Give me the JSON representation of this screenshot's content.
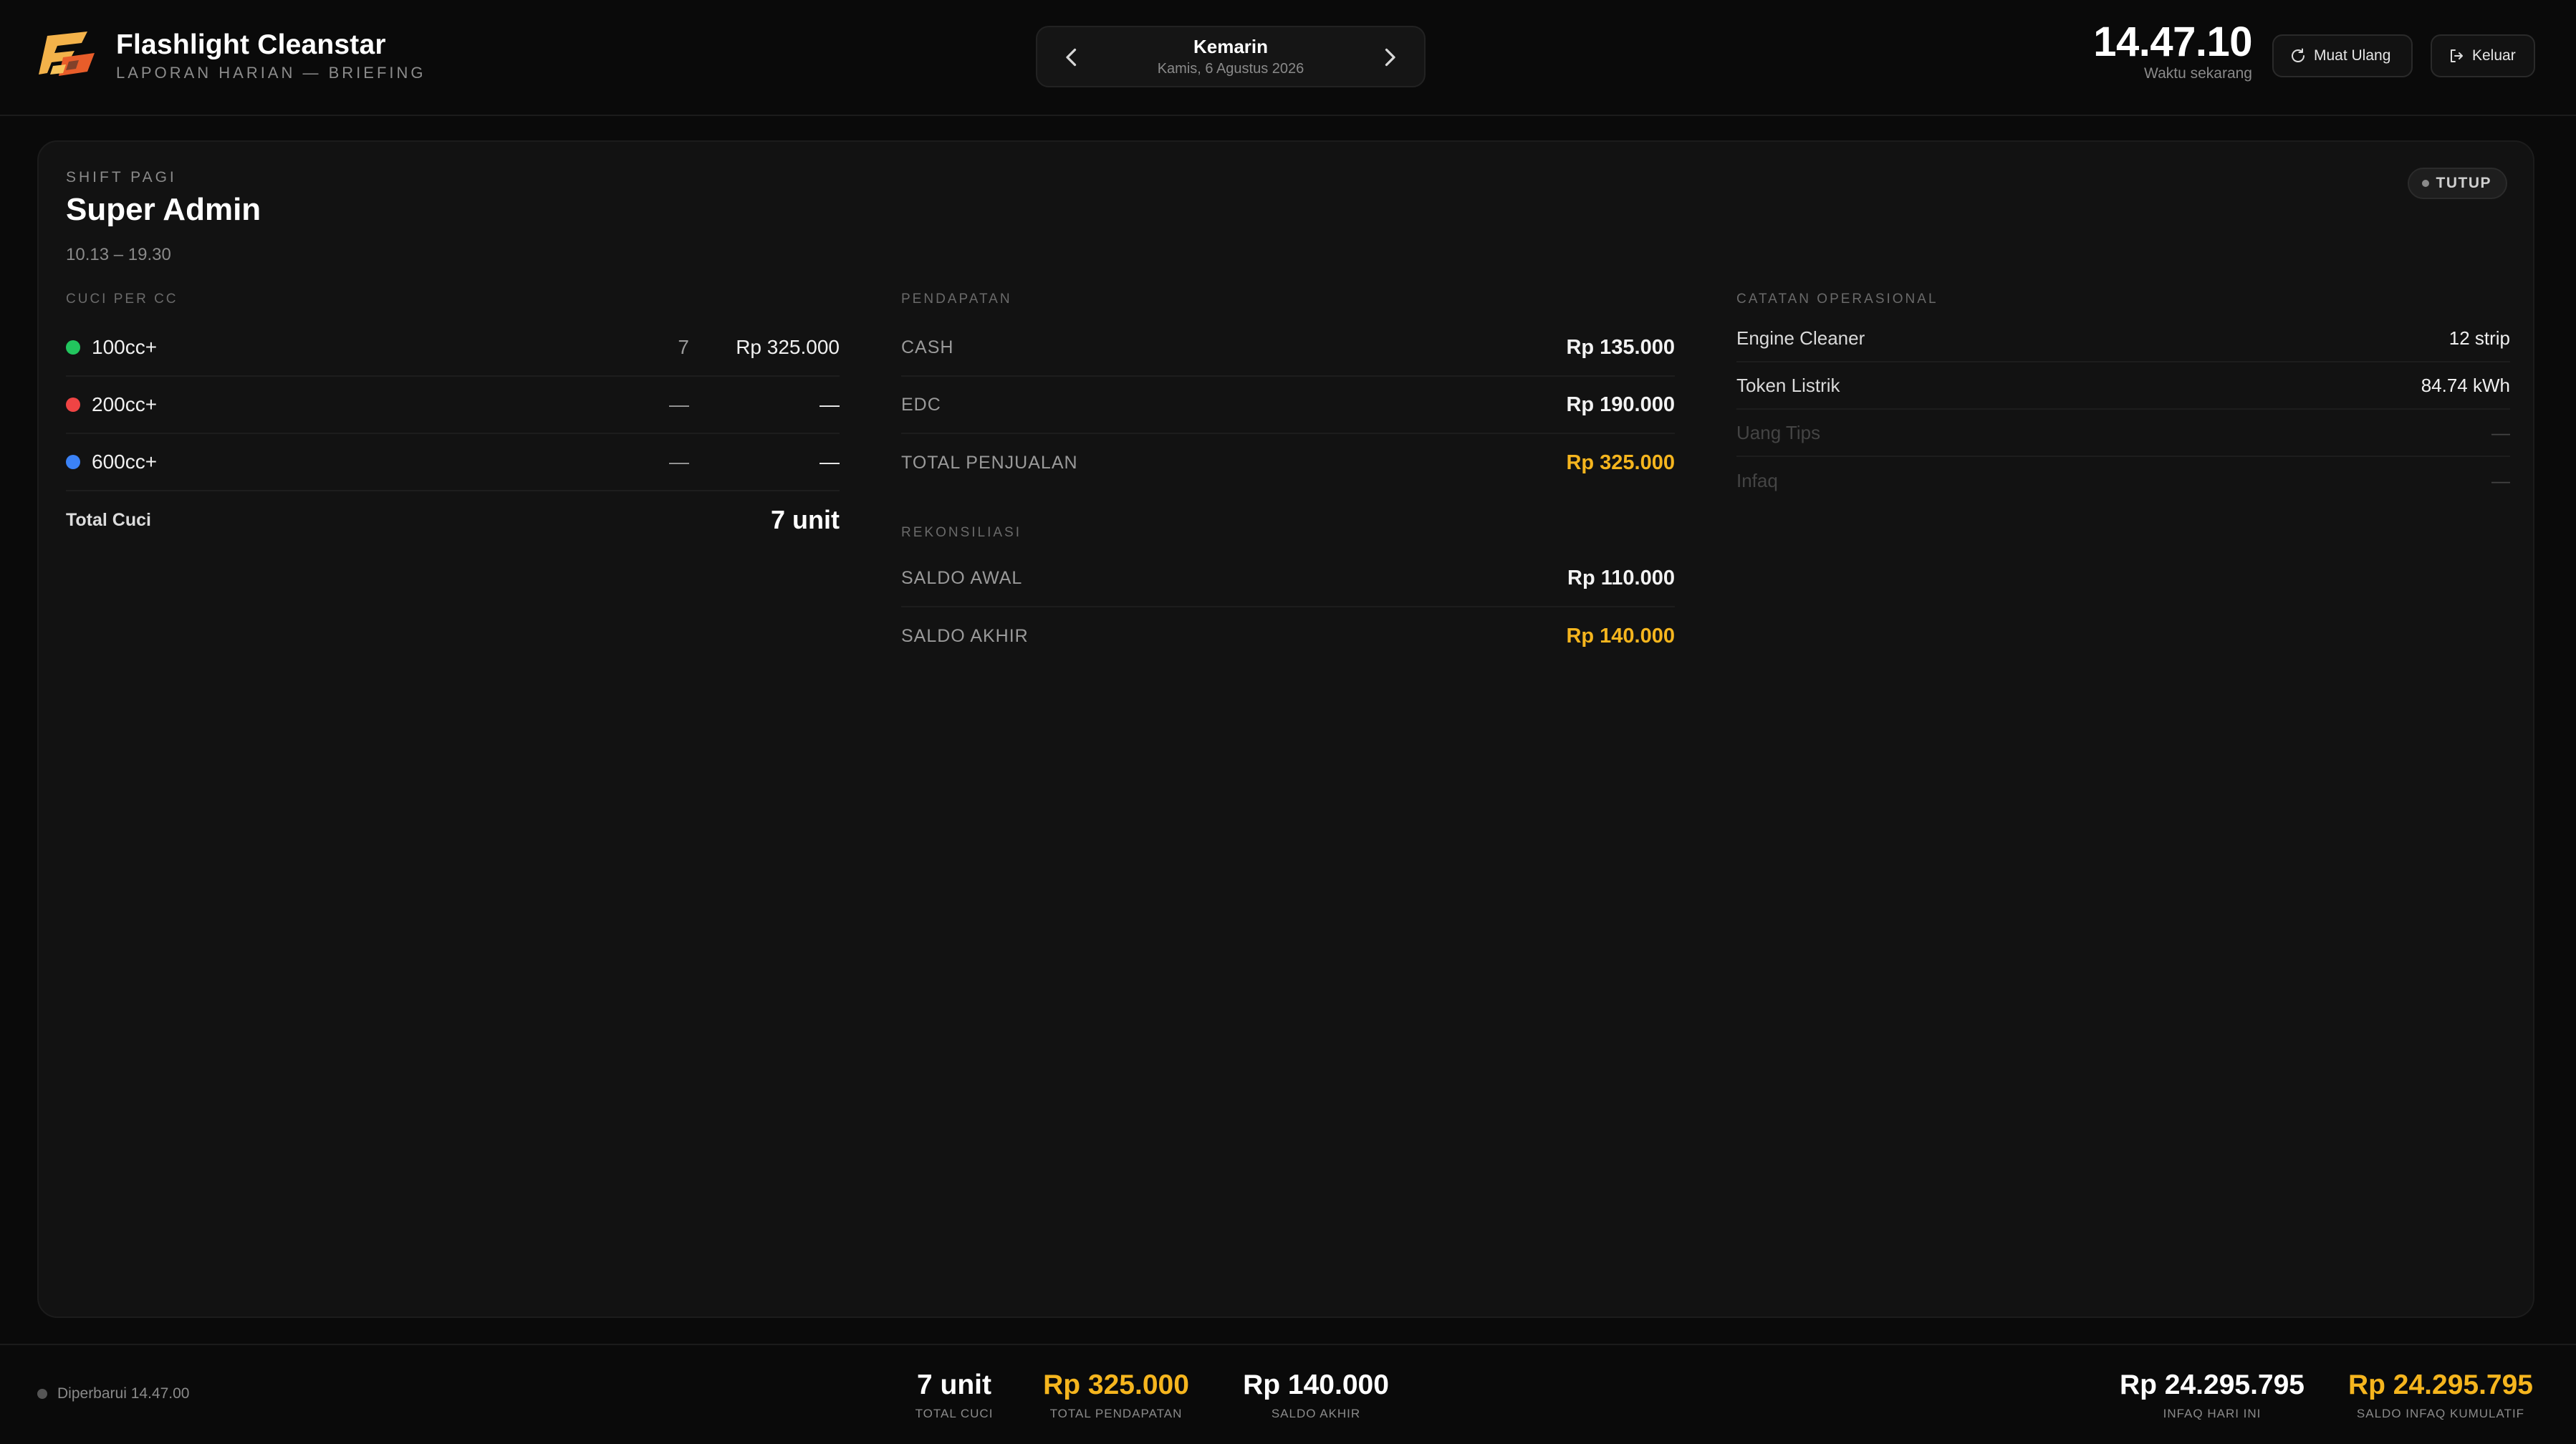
{
  "app": {
    "title": "Flashlight Cleanstar",
    "subtitle": "LAPORAN HARIAN — BRIEFING"
  },
  "date_nav": {
    "label": "Kemarin",
    "date": "Kamis, 6 Agustus 2026"
  },
  "clock": {
    "time": "14.47.10",
    "label": "Waktu sekarang"
  },
  "actions": {
    "reload_label": "Muat Ulang",
    "logout_label": "Keluar"
  },
  "shift": {
    "label": "SHIFT PAGI",
    "name": "Super Admin",
    "time_range": "10.13 – 19.30",
    "status": "TUTUP"
  },
  "cuci": {
    "heading": "CUCI PER CC",
    "rows": [
      {
        "name": "100cc+",
        "count": "7",
        "amount": "Rp 325.000",
        "color": "#22c55e"
      },
      {
        "name": "200cc+",
        "count": "—",
        "amount": "—",
        "color": "#ef4444"
      },
      {
        "name": "600cc+",
        "count": "—",
        "amount": "—",
        "color": "#3b82f6"
      }
    ],
    "total_label": "Total Cuci",
    "total_value": "7 unit"
  },
  "pendapatan": {
    "heading": "PENDAPATAN",
    "rows": [
      {
        "label": "CASH",
        "value": "Rp 135.000"
      },
      {
        "label": "EDC",
        "value": "Rp 190.000"
      },
      {
        "label": "TOTAL PENJUALAN",
        "value": "Rp 325.000"
      }
    ]
  },
  "rekonsiliasi": {
    "heading": "REKONSILIASI",
    "rows": [
      {
        "label": "SALDO AWAL",
        "value": "Rp 110.000"
      },
      {
        "label": "SALDO AKHIR",
        "value": "Rp 140.000"
      }
    ]
  },
  "operasional": {
    "heading": "CATATAN OPERASIONAL",
    "rows": [
      {
        "label": "Engine Cleaner",
        "value": "12 strip"
      },
      {
        "label": "Token Listrik",
        "value": "84.74 kWh"
      },
      {
        "label": "Uang Tips",
        "value": "—"
      },
      {
        "label": "Infaq",
        "value": "—"
      }
    ]
  },
  "footer": {
    "updated": "Diperbarui 14.47.00",
    "stats": [
      {
        "value": "7 unit",
        "label": "TOTAL CUCI"
      },
      {
        "value": "Rp 325.000",
        "label": "TOTAL PENDAPATAN"
      },
      {
        "value": "Rp 140.000",
        "label": "SALDO AKHIR"
      },
      {
        "value": "Rp 24.295.795",
        "label": "INFAQ HARI INI"
      },
      {
        "value": "Rp 24.295.795",
        "label": "SALDO INFAQ KUMULATIF"
      }
    ]
  },
  "colors": {
    "accent_gold": "#f5b51e",
    "background": "#0a0a0a",
    "card": "#121212"
  },
  "icons": {
    "logo": "flashlight-logo-icon",
    "prev": "chevron-left-icon",
    "next": "chevron-right-icon",
    "reload": "refresh-icon",
    "logout": "logout-icon"
  }
}
